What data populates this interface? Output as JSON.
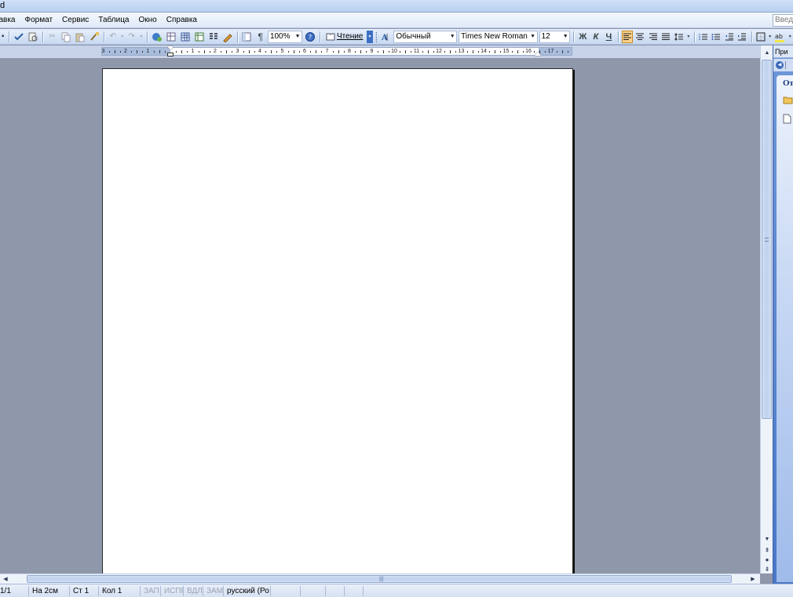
{
  "window": {
    "title_fragment": "d"
  },
  "menu": {
    "items": [
      "Вставка",
      "Формат",
      "Сервис",
      "Таблица",
      "Окно",
      "Справка"
    ],
    "visible_items": [
      "тавка",
      "Формат",
      "Сервис",
      "Таблица",
      "Окно",
      "Справка"
    ]
  },
  "help_box": {
    "placeholder": "Введ"
  },
  "toolbar": {
    "zoom": "100%",
    "reading_label": "Чтение",
    "style": "Обычный",
    "font": "Times New Roman",
    "size": "12",
    "bold": "Ж",
    "italic": "К",
    "underline": "Ч",
    "paragraph_mark": "¶"
  },
  "ruler": {
    "labels": [
      "3",
      "2",
      "1",
      "1",
      "2",
      "3",
      "4",
      "5",
      "6",
      "7",
      "8",
      "9",
      "10",
      "11",
      "12",
      "13",
      "14",
      "15",
      "16",
      "17"
    ]
  },
  "statusbar": {
    "pages": "1/1",
    "position": "На 2см",
    "line": "Ст 1",
    "column": "Кол 1",
    "rec": "ЗАП",
    "trk": "ИСПР",
    "ext": "ВДЛ",
    "ovr": "ЗАМ",
    "language": "русский (Ро"
  },
  "taskpane": {
    "title": "При",
    "section_title": "От"
  },
  "colors": {
    "accent": "#4b78c8",
    "workspace": "#8f97ab",
    "active_button": "#fbd38a"
  }
}
